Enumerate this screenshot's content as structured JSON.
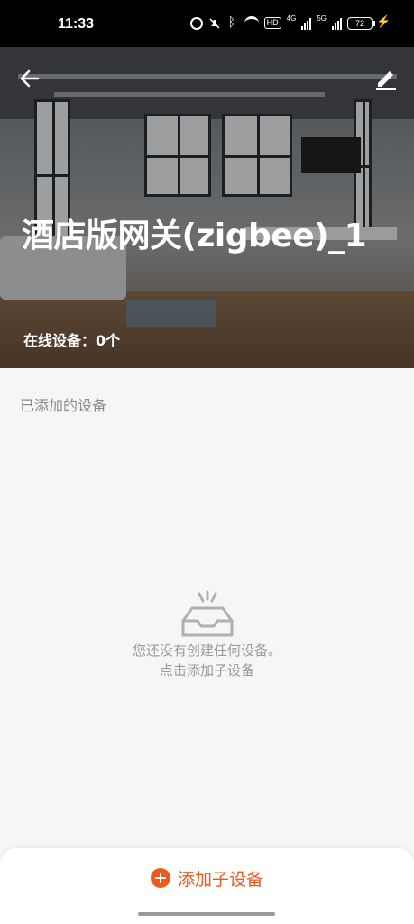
{
  "status_bar": {
    "time": "11:33",
    "hd_badge": "HD",
    "net1": "4G",
    "net2": "5G",
    "battery": "72"
  },
  "header": {
    "title": "酒店版网关(zigbee)_1",
    "online_devices": "在线设备：0个",
    "back_icon": "arrow-left-icon",
    "edit_icon": "pencil-icon"
  },
  "main": {
    "section_label": "已添加的设备",
    "empty_state": {
      "icon": "empty-tray-icon",
      "line1": "您还没有创建任何设备。",
      "line2": "点击添加子设备"
    }
  },
  "footer": {
    "add_label": "添加子设备",
    "add_icon": "plus-circle-icon",
    "accent_color": "#ef5a1c"
  }
}
